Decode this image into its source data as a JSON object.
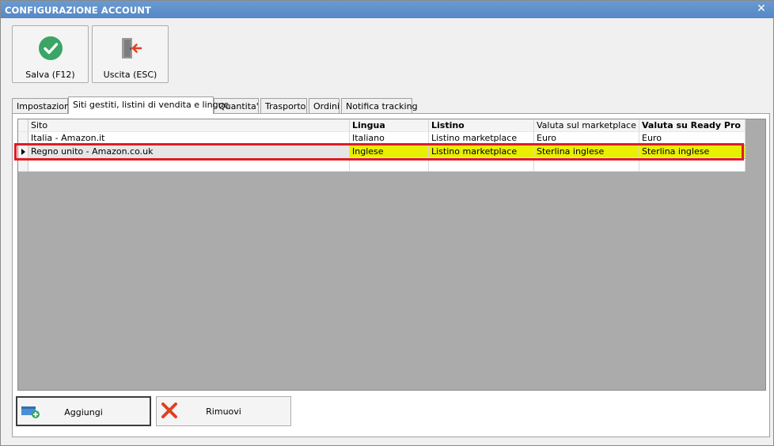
{
  "window": {
    "title": "CONFIGURAZIONE ACCOUNT",
    "close_glyph": "✕"
  },
  "toolbar": {
    "save": {
      "label": "Salva (F12)",
      "icon": "check-circle-icon",
      "color": "#3aa564"
    },
    "exit": {
      "label": "Uscita (ESC)",
      "icon": "door-exit-icon",
      "color": "#e04020"
    }
  },
  "tabs": [
    {
      "label": "Impostazioni",
      "active": false
    },
    {
      "label": "Siti gestiti, listini di vendita e lingue",
      "active": true
    },
    {
      "label": "Quantita'",
      "active": false
    },
    {
      "label": "Trasporto",
      "active": false
    },
    {
      "label": "Ordini",
      "active": false
    },
    {
      "label": "Notifica tracking",
      "active": false
    }
  ],
  "grid": {
    "columns": [
      "Sito",
      "Lingua",
      "Listino",
      "Valuta sul marketplace",
      "Valuta su Ready Pro"
    ],
    "rows": [
      {
        "sito": "Italia - Amazon.it",
        "lingua": "Italiano",
        "listino": "Listino marketplace",
        "valuta_marketplace": "Euro",
        "valuta_readypro": "Euro"
      },
      {
        "sito": "Regno unito - Amazon.co.uk",
        "lingua": "Inglese",
        "listino": "Listino marketplace",
        "valuta_marketplace": "Sterlina inglese",
        "valuta_readypro": "Sterlina inglese"
      }
    ],
    "highlight_color": "#e8ef00",
    "selection_box_color": "#e01b24"
  },
  "buttons": {
    "add": {
      "label": "Aggiungi",
      "icon": "add-row-icon"
    },
    "remove": {
      "label": "Rimuovi",
      "icon": "remove-x-icon",
      "color": "#e04020"
    }
  }
}
